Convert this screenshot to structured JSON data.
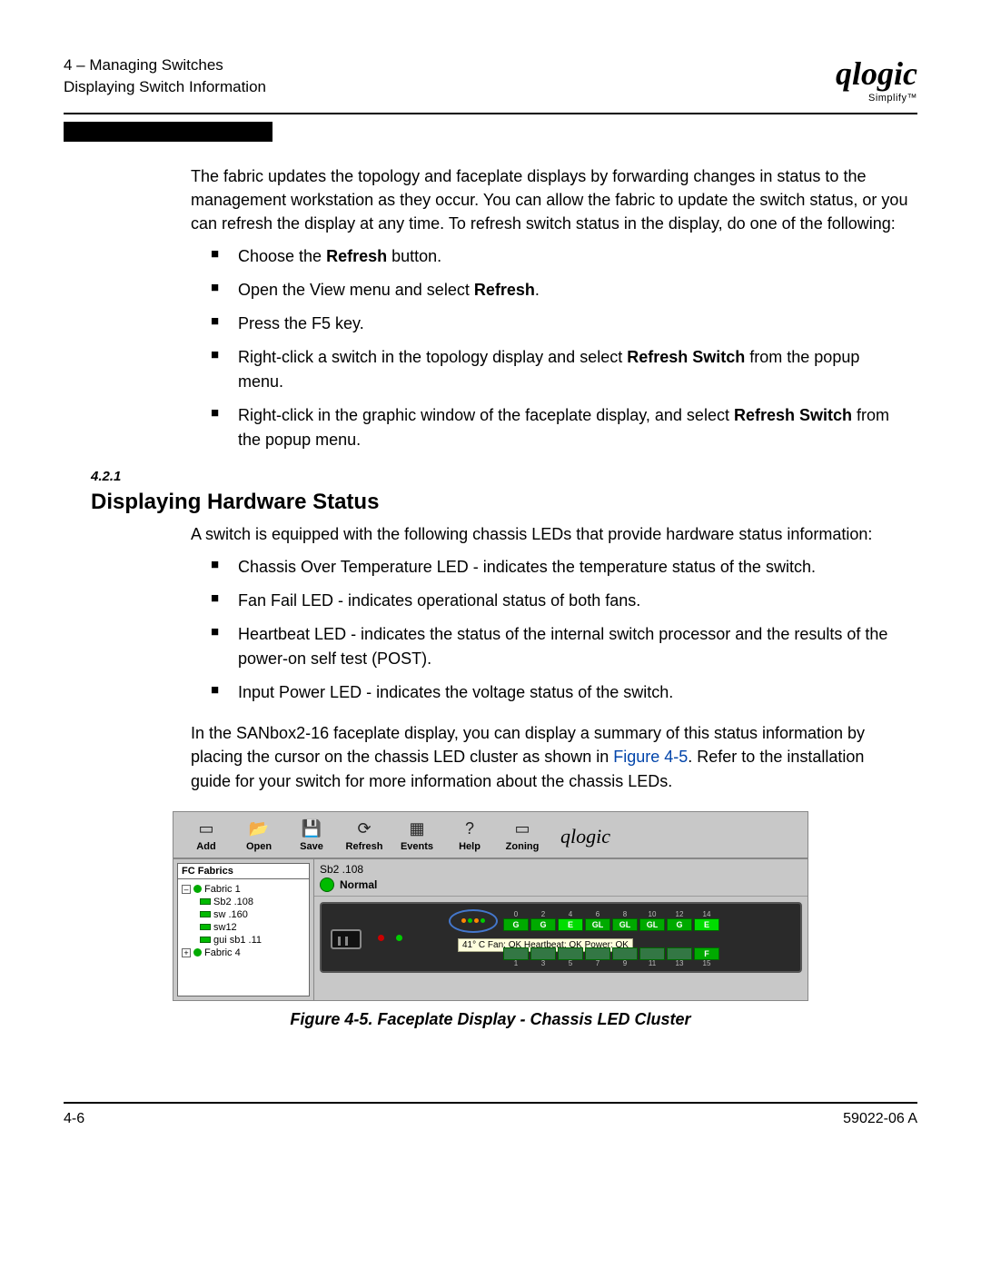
{
  "header": {
    "chapter": "4 – Managing Switches",
    "section": "Displaying Switch Information",
    "logo": "qlogic",
    "logo_sub": "Simplify™"
  },
  "body": {
    "intro": "The fabric updates the topology and faceplate displays by forwarding changes in status to the management workstation as they occur. You can allow the fabric to update the switch status, or you can refresh the display at any time. To refresh switch status in the display, do one of the following:",
    "bullets1": {
      "b0_a": "Choose the ",
      "b0_b": "Refresh",
      "b0_c": " button.",
      "b1_a": "Open the View menu and select ",
      "b1_b": "Refresh",
      "b1_c": ".",
      "b2": "Press the F5 key.",
      "b3_a": "Right-click a switch in the topology display and select ",
      "b3_b": "Refresh Switch",
      "b3_c": " from the popup menu.",
      "b4_a": "Right-click in the graphic window of the faceplate display, and select ",
      "b4_b": "Refresh Switch",
      "b4_c": " from the popup menu."
    },
    "secnum": "4.2.1",
    "heading": "Displaying Hardware Status",
    "p2": "A switch is equipped with the following chassis LEDs that provide hardware status information:",
    "bullets2": {
      "b0": "Chassis Over Temperature LED - indicates the temperature status of the switch.",
      "b1": "Fan Fail LED - indicates operational status of both fans.",
      "b2": "Heartbeat LED - indicates the status of the internal switch processor and the results of the power-on self test (POST).",
      "b3": "Input Power LED - indicates the voltage status of the switch."
    },
    "p3_a": "In the SANbox2-16 faceplate display, you can display a summary of this status information by placing the cursor on the chassis LED cluster as shown in ",
    "p3_link": "Figure 4-5",
    "p3_b": ". Refer to the installation guide for your switch for more information about the chassis LEDs.",
    "figcaption": "Figure 4-5.  Faceplate Display - Chassis LED Cluster"
  },
  "figure": {
    "toolbar": {
      "add": "Add",
      "open": "Open",
      "save": "Save",
      "refresh": "Refresh",
      "events": "Events",
      "help": "Help",
      "zoning": "Zoning",
      "logo": "qlogic"
    },
    "tree": {
      "header": "FC Fabrics",
      "fabric1": "Fabric 1",
      "n1": "Sb2 .108",
      "n2": "sw .160",
      "n3": "sw12",
      "n4": "gui sb1 .11",
      "fabric4": "Fabric 4"
    },
    "main": {
      "title": "Sb2 .108",
      "status": "Normal",
      "tooltip": "41° C Fan: OK Heartbeat: OK Power: OK",
      "ports_top": [
        {
          "n": "0",
          "l": "G"
        },
        {
          "n": "2",
          "l": "G"
        },
        {
          "n": "4",
          "l": "E"
        },
        {
          "n": "6",
          "l": "GL"
        },
        {
          "n": "8",
          "l": "GL"
        },
        {
          "n": "10",
          "l": "GL"
        },
        {
          "n": "12",
          "l": "G"
        },
        {
          "n": "14",
          "l": "E"
        }
      ],
      "ports_bot": [
        {
          "n": "1",
          "l": ""
        },
        {
          "n": "3",
          "l": ""
        },
        {
          "n": "5",
          "l": ""
        },
        {
          "n": "7",
          "l": ""
        },
        {
          "n": "9",
          "l": ""
        },
        {
          "n": "11",
          "l": ""
        },
        {
          "n": "13",
          "l": ""
        },
        {
          "n": "15",
          "l": "F"
        }
      ]
    }
  },
  "footer": {
    "left": "4-6",
    "right": "59022-06  A"
  }
}
